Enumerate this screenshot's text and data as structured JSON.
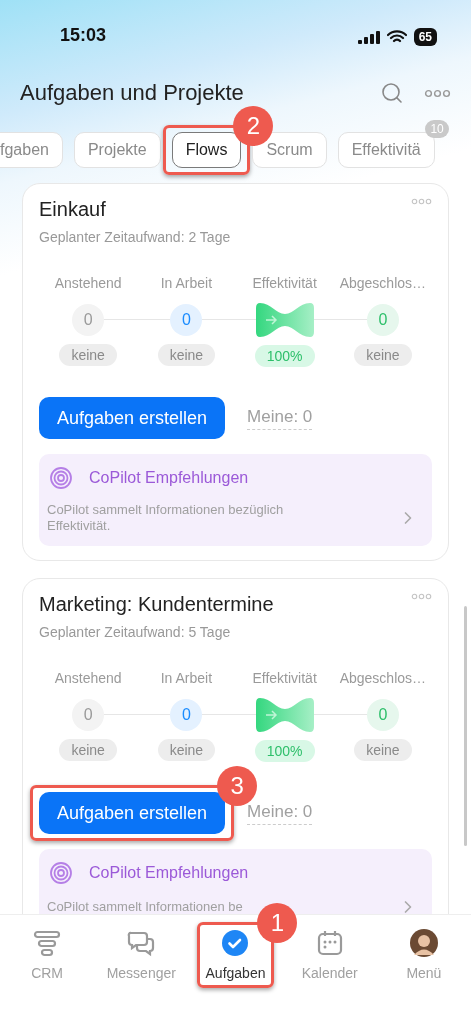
{
  "status_bar": {
    "time": "15:03",
    "battery": "65"
  },
  "header": {
    "title": "Aufgaben und Projekte"
  },
  "tabs": [
    {
      "label": "fgaben",
      "selected": false
    },
    {
      "label": "Projekte",
      "selected": false
    },
    {
      "label": "Flows",
      "selected": true,
      "callout": "2"
    },
    {
      "label": "Scrum",
      "selected": false
    },
    {
      "label": "Effektivitä",
      "selected": false,
      "badge": "10"
    }
  ],
  "flows": [
    {
      "title": "Einkauf",
      "subtitle": "Geplanter Zeitaufwand: 2 Tage",
      "stages": [
        {
          "kind": "count",
          "label": "Anstehend",
          "value": "0",
          "pill": "keine",
          "color": "#9a9a9a"
        },
        {
          "kind": "count",
          "label": "In Arbeit",
          "value": "0",
          "pill": "keine",
          "color": "#1a8cff"
        },
        {
          "kind": "gauge",
          "label": "Effektivität",
          "pill": "100%"
        },
        {
          "kind": "count",
          "label": "Abgeschlos…",
          "value": "0",
          "pill": "keine",
          "color": "#2dbf6a"
        }
      ],
      "create_button": {
        "label": "Aufgaben erstellen"
      },
      "mine": "Meine: 0",
      "copilot": {
        "title": "CoPilot Empfehlungen",
        "text": "CoPilot sammelt Informationen bezüglich Effektivität."
      }
    },
    {
      "title": "Marketing: Kundentermine",
      "subtitle": "Geplanter Zeitaufwand: 5 Tage",
      "stages": [
        {
          "kind": "count",
          "label": "Anstehend",
          "value": "0",
          "pill": "keine",
          "color": "#9a9a9a"
        },
        {
          "kind": "count",
          "label": "In Arbeit",
          "value": "0",
          "pill": "keine",
          "color": "#1a8cff"
        },
        {
          "kind": "gauge",
          "label": "Effektivität",
          "pill": "100%"
        },
        {
          "kind": "count",
          "label": "Abgeschlos…",
          "value": "0",
          "pill": "keine",
          "color": "#2dbf6a"
        }
      ],
      "create_button": {
        "label": "Aufgaben erstellen",
        "callout": "3"
      },
      "mine": "Meine: 0",
      "copilot": {
        "title": "CoPilot Empfehlungen",
        "text": "CoPilot sammelt Informationen be"
      }
    }
  ],
  "nav": [
    {
      "kind": "crm",
      "label": "CRM",
      "selected": false
    },
    {
      "kind": "messenger",
      "label": "Messenger",
      "selected": false
    },
    {
      "kind": "tasks",
      "label": "Aufgaben",
      "selected": true,
      "callout": "1"
    },
    {
      "kind": "calendar",
      "label": "Kalender",
      "selected": false
    },
    {
      "kind": "avatar",
      "label": "Menü",
      "selected": false
    }
  ]
}
